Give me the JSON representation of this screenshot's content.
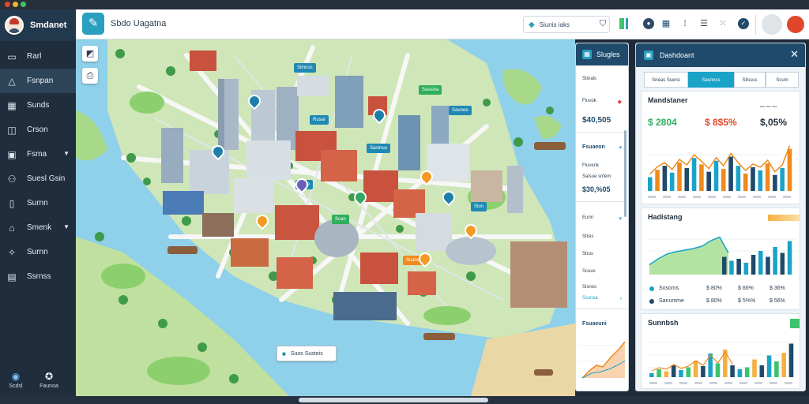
{
  "app": {
    "brand_name": "Smdanet",
    "title": "Sbdo Uagatna"
  },
  "sidebar": {
    "items": [
      {
        "label": "Rarl",
        "icon": "folder-icon"
      },
      {
        "label": "Fsnpan",
        "icon": "alert-icon"
      },
      {
        "label": "Sunds",
        "icon": "grid-icon"
      },
      {
        "label": "Crson",
        "icon": "lock-icon"
      },
      {
        "label": "Fsma",
        "icon": "monitor-icon"
      },
      {
        "label": "Suesl Gsin",
        "icon": "users-icon"
      },
      {
        "label": "Surnn",
        "icon": "document-icon"
      },
      {
        "label": "Smenk",
        "icon": "chart-icon"
      },
      {
        "label": "Surnn",
        "icon": "tools-icon"
      },
      {
        "label": "Ssrnss",
        "icon": "list-icon"
      }
    ],
    "bottom": [
      {
        "label": "Scdsl"
      },
      {
        "label": "Faunoa"
      }
    ]
  },
  "header": {
    "search_value": "Siunis iaks"
  },
  "map": {
    "labels": [
      {
        "text": "Siinnos",
        "color": "blue"
      },
      {
        "text": "Sassina",
        "color": "green"
      },
      {
        "text": "Saunee",
        "color": "blue"
      },
      {
        "text": "Rusar",
        "color": "blue"
      },
      {
        "text": "Saninuu",
        "color": "blue"
      },
      {
        "text": "Siun",
        "color": "blue"
      },
      {
        "text": "Sane",
        "color": "blue"
      },
      {
        "text": "Scan",
        "color": "green"
      },
      {
        "text": "Suanenu",
        "color": "orange"
      }
    ],
    "callout": "Suos Susteis"
  },
  "layers": {
    "title": "Slugles",
    "rows": [
      {
        "type": "label",
        "text": "Stinals"
      },
      {
        "type": "label",
        "text": "Fluvok"
      },
      {
        "type": "value",
        "text": "$40,505"
      },
      {
        "type": "section",
        "text": "Fsuaeon"
      },
      {
        "type": "label",
        "text": "Fluvenk"
      },
      {
        "type": "label",
        "text": "Saisue snfem"
      },
      {
        "type": "value",
        "text": "$30,%05"
      },
      {
        "type": "label",
        "text": "Eunn"
      },
      {
        "type": "label",
        "text": "Stisis"
      },
      {
        "type": "label",
        "text": "Strus"
      },
      {
        "type": "label",
        "text": "Scuus"
      },
      {
        "type": "label",
        "text": "Sisnos"
      },
      {
        "type": "link",
        "text": "Sssnsa"
      },
      {
        "type": "section",
        "text": "Fsuaeuni"
      }
    ]
  },
  "dashboard": {
    "title": "Dashdoant",
    "tabs": [
      "Sneas Suens",
      "Sasnnss",
      "Slissus",
      "Scum"
    ],
    "card1": {
      "title": "Mandstaner",
      "stats": [
        {
          "value": "$ 2804",
          "color": "#2fae5c"
        },
        {
          "value": "$ 8$5%",
          "color": "#e0462b"
        },
        {
          "value": "$,05%",
          "color": "#1f2d3c"
        }
      ]
    },
    "card2": {
      "title": "Hadistang",
      "rows": [
        {
          "dot": "#1aa3c8",
          "a": "Sosoms",
          "b": "$ 80%",
          "c": "$ 66%",
          "d": "$ 36%"
        },
        {
          "dot": "#1f4a6b",
          "a": "Sanumme",
          "b": "$ 80%",
          "c": "$ 5%%",
          "d": "$ 56%"
        }
      ]
    },
    "card3": {
      "title": "Sunnbsh"
    },
    "charts": {
      "bar1": [
        0.3,
        0.46,
        0.55,
        0.4,
        0.62,
        0.5,
        0.72,
        0.58,
        0.42,
        0.66,
        0.48,
        0.75,
        0.55,
        0.38,
        0.52,
        0.45,
        0.6,
        0.35,
        0.5,
        0.92
      ],
      "area2": [
        0.25,
        0.4,
        0.52,
        0.58,
        0.62,
        0.66,
        0.72,
        0.86,
        0.95,
        0.55,
        0.45,
        0.35,
        0.4,
        0.3,
        0.5,
        0.6,
        0.45,
        0.7,
        0.55,
        0.85
      ],
      "bar3": [
        0.1,
        0.2,
        0.15,
        0.3,
        0.18,
        0.25,
        0.42,
        0.28,
        0.6,
        0.35,
        0.7,
        0.3,
        0.2,
        0.25,
        0.45,
        0.3,
        0.55,
        0.4,
        0.62,
        0.85
      ]
    }
  }
}
